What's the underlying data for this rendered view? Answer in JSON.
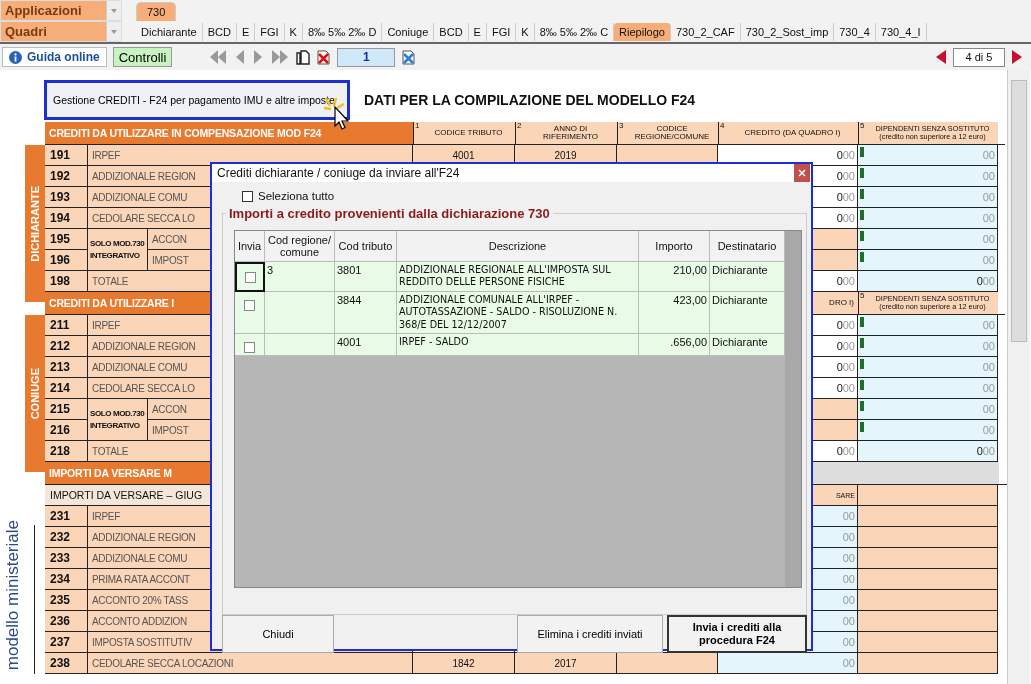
{
  "app_selector": {
    "label": "Applicazioni"
  },
  "module_tabs": [
    {
      "label": "730",
      "selected": true
    }
  ],
  "section_selector": {
    "label": "Quadri"
  },
  "section_tabs": [
    {
      "label": "Dichiarante",
      "selected": false
    },
    {
      "label": "BCD",
      "selected": false
    },
    {
      "label": "E",
      "selected": false
    },
    {
      "label": "FGI",
      "selected": false
    },
    {
      "label": "K",
      "selected": false
    },
    {
      "label": "8‰ 5‰ 2‰ D",
      "selected": false
    },
    {
      "label": "Coniuge",
      "selected": false
    },
    {
      "label": "BCD",
      "selected": false
    },
    {
      "label": "E",
      "selected": false
    },
    {
      "label": "FGI",
      "selected": false
    },
    {
      "label": "K",
      "selected": false
    },
    {
      "label": "8‰ 5‰ 2‰ C",
      "selected": false
    },
    {
      "label": "Riepilogo",
      "selected": true
    },
    {
      "label": "730_2_CAF",
      "selected": false
    },
    {
      "label": "730_2_Sost_imp",
      "selected": false
    },
    {
      "label": "730_4",
      "selected": false
    },
    {
      "label": "730_4_I",
      "selected": false
    }
  ],
  "toolbar": {
    "help_button": "Guida online",
    "checks_button": "Controlli",
    "page_number": "1",
    "page_counter": "4 di 5"
  },
  "form": {
    "credits_button": "Gestione CREDITI -  F24 per pagamento IMU e altre imposte",
    "title": "DATI PER LA COMPILAZIONE DEL MODELLO F24",
    "sections": [
      {
        "kind": "credit",
        "band": "DICHIARANTE",
        "header": {
          "title": "CREDITI DA UTILIZZARE IN COMPENSAZIONE MOD F24",
          "columns": [
            {
              "number": "1",
              "label": "CODICE TRIBUTO"
            },
            {
              "number": "2",
              "label": "ANNO DI RIFERIMENTO"
            },
            {
              "number": "3",
              "label": "CODICE REGIONE/COMUNE"
            }
          ],
          "credit": {
            "number": "4",
            "label": "CREDITO (DA QUADRO I)"
          },
          "col5": {
            "number": "5",
            "label": "DIPENDENTI SENZA SOSTITUTO (credito non superiore a 12 euro)"
          }
        },
        "rows": [
          {
            "kind": "row",
            "code": "191",
            "label": "IRPEF",
            "tributo": "4001",
            "anno": "2019",
            "credit": "0",
            "credit_decimals": "00",
            "flag": true,
            "col5": "00"
          },
          {
            "kind": "row",
            "code": "192",
            "label": "ADDIZIONALE REGION",
            "credit": "0",
            "credit_decimals": "00",
            "flag": true,
            "col5": "00"
          },
          {
            "kind": "row",
            "code": "193",
            "label": "ADDIZIONALE COMU",
            "credit": "0",
            "credit_decimals": "00",
            "flag": true,
            "col5": "00"
          },
          {
            "kind": "row",
            "code": "194",
            "label": "CEDOLARE SECCA LO",
            "credit": "0",
            "credit_decimals": "00",
            "flag": true,
            "col5": "00"
          },
          {
            "kind": "pair",
            "prefix": "SOLO MOD.730 INTEGRATIVO",
            "rows": [
              {
                "code": "195",
                "label": "ACCON",
                "flag": true,
                "col5": "00"
              },
              {
                "code": "196",
                "label": "IMPOST",
                "flag": true,
                "col5": "00"
              }
            ]
          },
          {
            "kind": "row",
            "code": "198",
            "label": "TOTALE",
            "credit": "0",
            "credit_decimals": "00",
            "col5_units": "0",
            "col5": "00"
          }
        ]
      },
      {
        "kind": "credit",
        "band": "CONIUGE",
        "header": {
          "title": "CREDITI DA UTILIZZARE I",
          "credit": {
            "label": "DRO I)"
          },
          "col5": {
            "number": "5",
            "label": "DIPENDENTI SENZA SOSTITUTO (credito non superiore a 12 euro)"
          }
        },
        "rows": [
          {
            "kind": "row",
            "code": "211",
            "label": "IRPEF",
            "credit": "0",
            "credit_decimals": "00",
            "flag": true,
            "col5": "00"
          },
          {
            "kind": "row",
            "code": "212",
            "label": "ADDIZIONALE REGION",
            "credit": "0",
            "credit_decimals": "00",
            "flag": true,
            "col5": "00"
          },
          {
            "kind": "row",
            "code": "213",
            "label": "ADDIZIONALE COMU",
            "credit": "0",
            "credit_decimals": "00",
            "flag": true,
            "col5": "00"
          },
          {
            "kind": "row",
            "code": "214",
            "label": "CEDOLARE SECCA LO",
            "credit": "0",
            "credit_decimals": "00",
            "flag": true,
            "col5": "00"
          },
          {
            "kind": "pair",
            "prefix": "SOLO MOD.730 INTEGRATIVO",
            "rows": [
              {
                "code": "215",
                "label": "ACCON",
                "flag": true,
                "col5": "00"
              },
              {
                "code": "216",
                "label": "IMPOST",
                "flag": true,
                "col5": "00"
              }
            ]
          },
          {
            "kind": "row",
            "code": "218",
            "label": "TOTALE",
            "credit": "0",
            "credit_decimals": "00",
            "col5_units": "0",
            "col5": "00"
          }
        ]
      },
      {
        "kind": "payment",
        "side_label": "modello ministeriale",
        "header": {
          "title": "IMPORTI DA VERSARE M"
        },
        "subheader": {
          "label": "IMPORTI DA VERSARE – GIUG",
          "credit_label": "SARE"
        },
        "rows": [
          {
            "kind": "row",
            "code": "231",
            "label": "IRPEF",
            "credit_decimals": "00"
          },
          {
            "kind": "row",
            "code": "232",
            "label": "ADDIZIONALE REGION",
            "credit_decimals": "00"
          },
          {
            "kind": "row",
            "code": "233",
            "label": "ADDIZIONALE COMU",
            "credit_decimals": "00"
          },
          {
            "kind": "row",
            "code": "234",
            "label": "PRIMA RATA ACCONT",
            "credit_decimals": "00"
          },
          {
            "kind": "row",
            "code": "235",
            "label": "ACCONTO 20% TASS",
            "credit_decimals": "00"
          },
          {
            "kind": "row",
            "code": "236",
            "label": "ACCONTO ADDIZION",
            "credit_decimals": "00"
          },
          {
            "kind": "row",
            "code": "237",
            "label": "IMPOSTA SOSTITUTIV",
            "credit_decimals": "00"
          },
          {
            "kind": "row",
            "code": "238",
            "label": "CEDOLARE SECCA LOCAZIONI",
            "tributo": "1842",
            "anno": "2017",
            "credit_decimals": "00"
          }
        ]
      }
    ]
  },
  "dialog": {
    "title": "Crediti dichiarante / coniuge da inviare all'F24",
    "select_all": {
      "label": "Seleziona tutto",
      "checked": false
    },
    "group_title": "Importi a credito provenienti dalla dichiarazione 730",
    "columns": [
      "Invia",
      "Cod regione/ comune",
      "Cod tributo",
      "Descrizione",
      "Importo",
      "Destinatario"
    ],
    "rows": [
      {
        "send": false,
        "focused": true,
        "region": "3",
        "tributo": "3801",
        "description": "ADDIZIONALE REGIONALE ALL'IMPOSTA SUL REDDITO DELLE PERSONE FISICHE",
        "amount": "210,00",
        "recipient": "Dichiarante"
      },
      {
        "send": false,
        "focused": false,
        "tributo": "3844",
        "description": "ADDIZIONALE COMUNALE ALL'IRPEF - AUTOTASSAZIONE - SALDO - RISOLUZIONE N. 368/E DEL 12/12/2007",
        "amount": "423,00",
        "recipient": "Dichiarante"
      },
      {
        "send": false,
        "focused": false,
        "tributo": "4001",
        "description": "IRPEF - SALDO",
        "amount": ".656,00",
        "recipient": "Dichiarante"
      }
    ],
    "buttons": [
      {
        "label": "Chiudi"
      },
      {
        "label": "Elimina i crediti inviati"
      },
      {
        "label": "Invia i crediti alla procedura F24",
        "default": true
      }
    ]
  }
}
